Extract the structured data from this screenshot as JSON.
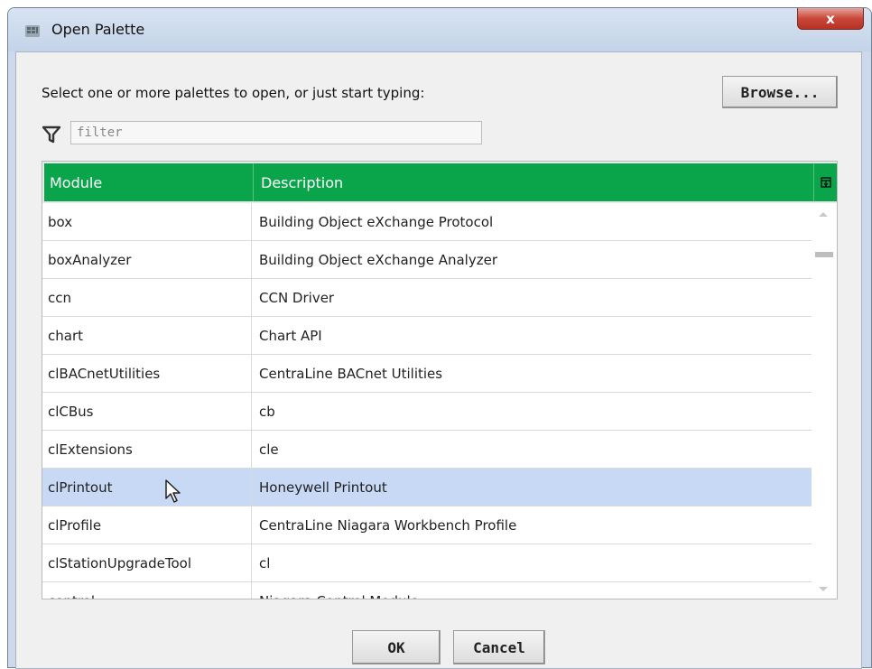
{
  "window": {
    "title": "Open Palette",
    "close_label": "x"
  },
  "prompt": "Select one or more palettes to open, or just start typing:",
  "browse_label": "Browse...",
  "filter": {
    "placeholder": "filter",
    "value": ""
  },
  "table": {
    "columns": [
      "Module",
      "Description"
    ],
    "rows": [
      {
        "module": "box",
        "description": "Building Object eXchange Protocol"
      },
      {
        "module": "boxAnalyzer",
        "description": "Building Object eXchange Analyzer"
      },
      {
        "module": "ccn",
        "description": "CCN Driver"
      },
      {
        "module": "chart",
        "description": "Chart API"
      },
      {
        "module": "clBACnetUtilities",
        "description": "CentraLine BACnet Utilities"
      },
      {
        "module": "clCBus",
        "description": "cb"
      },
      {
        "module": "clExtensions",
        "description": "cle"
      },
      {
        "module": "clPrintout",
        "description": "Honeywell Printout"
      },
      {
        "module": "clProfile",
        "description": "CentraLine Niagara Workbench Profile"
      },
      {
        "module": "clStationUpgradeTool",
        "description": "cl"
      },
      {
        "module": "control",
        "description": "Niagara Control Module"
      }
    ],
    "selected_row": 7
  },
  "buttons": {
    "ok": "OK",
    "cancel": "Cancel"
  },
  "colors": {
    "header_green": "#0aa54a",
    "selection_blue": "#c7d9f5"
  }
}
